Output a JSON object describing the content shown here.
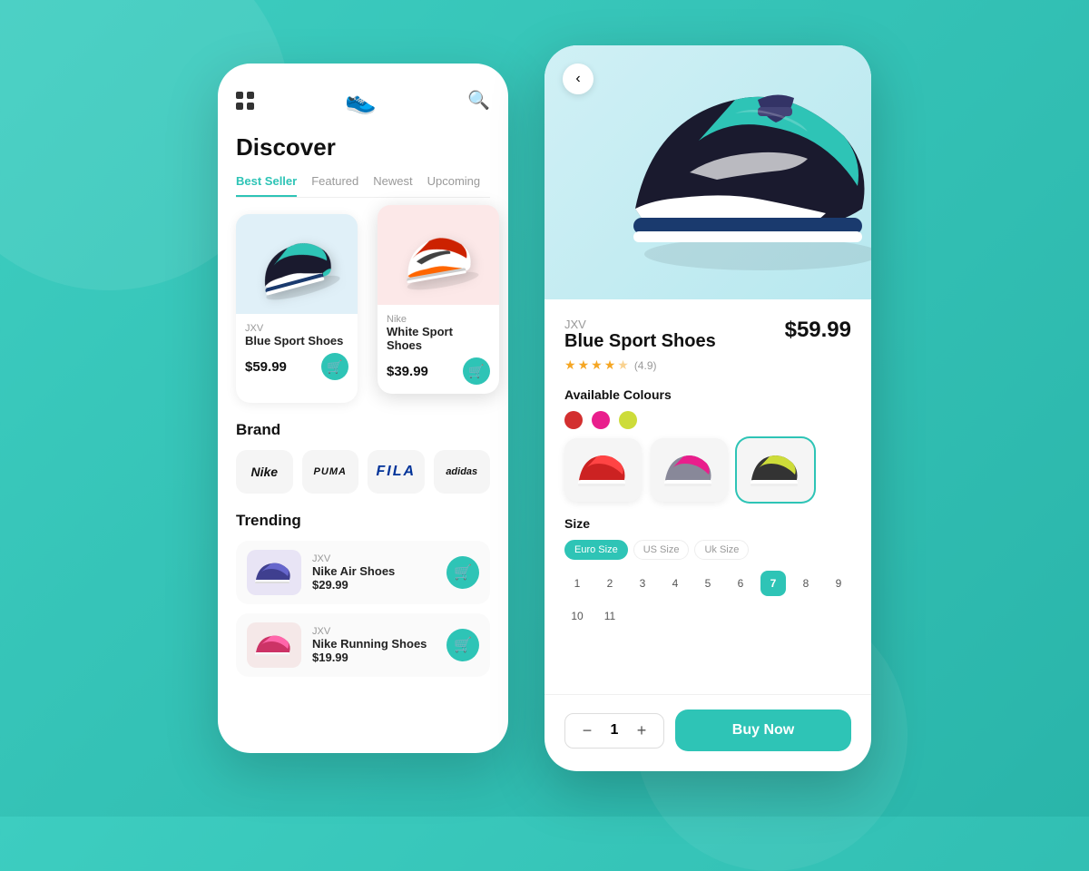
{
  "background": "#2ec4b6",
  "left_phone": {
    "header": {
      "logo": "👟",
      "search_label": "🔍"
    },
    "title": "Discover",
    "tabs": [
      {
        "label": "Best Seller",
        "active": true
      },
      {
        "label": "Featured",
        "active": false
      },
      {
        "label": "Newest",
        "active": false
      },
      {
        "label": "Upcoming",
        "active": false
      }
    ],
    "products": [
      {
        "brand": "JXV",
        "name": "Blue Sport Shoes",
        "price": "$59.99",
        "bg": "blue",
        "emoji": "👟"
      },
      {
        "brand": "Nike",
        "name": "White Sport Shoes",
        "price": "$39.99",
        "bg": "pink",
        "emoji": "👟"
      }
    ],
    "brands_section": {
      "title": "Brand",
      "brands": [
        "Nike",
        "PUMA",
        "FILA",
        "adidas"
      ]
    },
    "trending_section": {
      "title": "Trending",
      "items": [
        {
          "brand": "JXV",
          "name": "Nike Air Shoes",
          "price": "$29.99",
          "bg": "purple",
          "emoji": "👟"
        },
        {
          "brand": "JXV",
          "name": "Nike Running Shoes",
          "price": "$19.99",
          "bg": "pink",
          "emoji": "👟"
        }
      ]
    }
  },
  "right_phone": {
    "product": {
      "brand": "JXV",
      "name": "Blue Sport Shoes",
      "price": "$59.99",
      "rating": 4.9,
      "rating_count": "(4.9)"
    },
    "colours_label": "Available Colours",
    "colours": [
      {
        "hex": "#d32f2f",
        "active": false
      },
      {
        "hex": "#e91e8c",
        "active": false
      },
      {
        "hex": "#cddc39",
        "active": true
      }
    ],
    "size_label": "Size",
    "size_tabs": [
      {
        "label": "Euro Size",
        "active": true
      },
      {
        "label": "US Size",
        "active": false
      },
      {
        "label": "Uk Size",
        "active": false
      }
    ],
    "sizes": [
      1,
      2,
      3,
      4,
      5,
      6,
      7,
      8,
      9,
      10,
      11
    ],
    "selected_size": 7,
    "quantity": 1,
    "buy_now_label": "Buy Now"
  }
}
